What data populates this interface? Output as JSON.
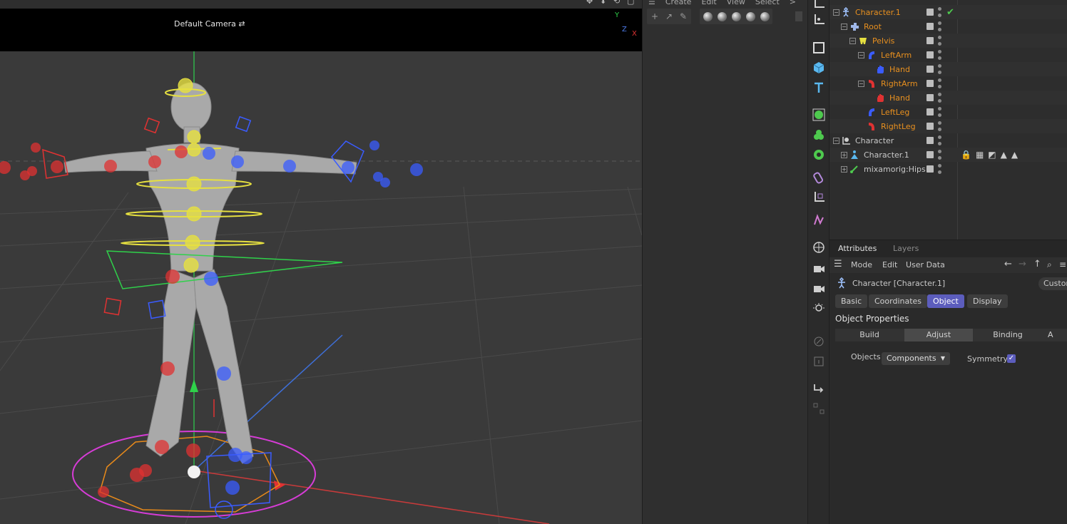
{
  "viewport": {
    "camera_label": "Default Camera",
    "axis_y": "Y",
    "axis_z": "Z",
    "axis_x": "X"
  },
  "mid_panel": {
    "menu": [
      "Create",
      "Edit",
      "View",
      "Select",
      ">"
    ]
  },
  "object_manager": {
    "rows": [
      {
        "label": "Character.1",
        "color": "orange",
        "icon": "character-icon",
        "check": "✔"
      },
      {
        "label": "Root",
        "color": "orange",
        "icon": "component-root-icon"
      },
      {
        "label": "Pelvis",
        "color": "orange",
        "icon": "pelvis-icon"
      },
      {
        "label": "LeftArm",
        "color": "orange",
        "icon": "left-arm-icon"
      },
      {
        "label": "Hand",
        "color": "orange",
        "icon": "left-hand-icon"
      },
      {
        "label": "RightArm",
        "color": "orange",
        "icon": "right-arm-icon"
      },
      {
        "label": "Hand",
        "color": "orange",
        "icon": "right-hand-icon"
      },
      {
        "label": "LeftLeg",
        "color": "orange",
        "icon": "left-leg-icon"
      },
      {
        "label": "RightLeg",
        "color": "orange",
        "icon": "right-leg-icon"
      },
      {
        "label": "Character",
        "color": "grey",
        "icon": "null-character-icon"
      },
      {
        "label": "Character.1",
        "color": "grey",
        "icon": "mesh-character-icon"
      },
      {
        "label": "mixamorig:Hips",
        "color": "grey",
        "icon": "joint-icon"
      }
    ]
  },
  "attributes": {
    "tabs": [
      "Attributes",
      "Layers"
    ],
    "menu": [
      "Mode",
      "Edit",
      "User Data"
    ],
    "title": "Character [Character.1]",
    "custom": "Custom",
    "tab_buttons": [
      "Basic",
      "Coordinates",
      "Object",
      "Display"
    ],
    "section": "Object Properties",
    "sub_tabs": [
      "Build",
      "Adjust",
      "Binding",
      "A"
    ],
    "objects_label": "Objects",
    "objects_value": "Components",
    "symmetry_label": "Symmetry",
    "symmetry_check": "✓"
  },
  "colors": {
    "accent": "#5c5dbd",
    "orange_text": "#e8901f",
    "left_side": "#3a5cff",
    "right_side": "#e03232",
    "center": "#e6e040"
  }
}
